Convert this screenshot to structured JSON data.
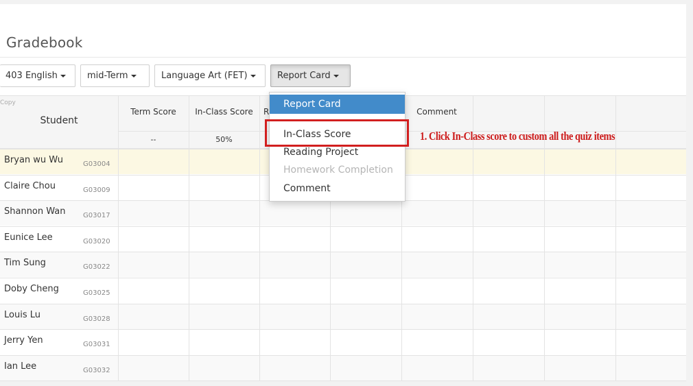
{
  "app": {
    "title": "Gradebook"
  },
  "toolbar": {
    "class_select": "403 English",
    "term_select": "mid-Term",
    "subject_select": "Language Art (FET)",
    "view_select": "Report Card"
  },
  "table": {
    "copy_label": "Copy",
    "student_header": "Student",
    "columns": [
      "Term Score",
      "In-Class Score",
      "R",
      "",
      "Comment",
      "",
      "",
      ""
    ],
    "subvalues": [
      "--",
      "50%"
    ],
    "students": [
      {
        "name": "Bryan wu Wu",
        "id": "G03004"
      },
      {
        "name": "Claire Chou",
        "id": "G03009"
      },
      {
        "name": "Shannon Wan",
        "id": "G03017"
      },
      {
        "name": "Eunice Lee",
        "id": "G03020"
      },
      {
        "name": "Tim Sung",
        "id": "G03022"
      },
      {
        "name": "Doby Cheng",
        "id": "G03025"
      },
      {
        "name": "Louis Lu",
        "id": "G03028"
      },
      {
        "name": "Jerry Yen",
        "id": "G03031"
      },
      {
        "name": "Ian Lee",
        "id": "G03032"
      }
    ]
  },
  "dropdown": {
    "items": [
      {
        "label": "Report Card",
        "state": "active"
      },
      {
        "label": "In-Class Score",
        "state": "normal"
      },
      {
        "label": "Reading Project",
        "state": "normal"
      },
      {
        "label": "Homework Completion",
        "state": "disabled"
      },
      {
        "label": "Comment",
        "state": "normal"
      }
    ]
  },
  "annotation": {
    "text": "1. Click In-Class score to custom all the quiz items",
    "color": "#cc1b1b"
  },
  "colors": {
    "accent": "#428bca",
    "highlight_row": "#fcf8e3",
    "annotation": "#d21f1f"
  }
}
